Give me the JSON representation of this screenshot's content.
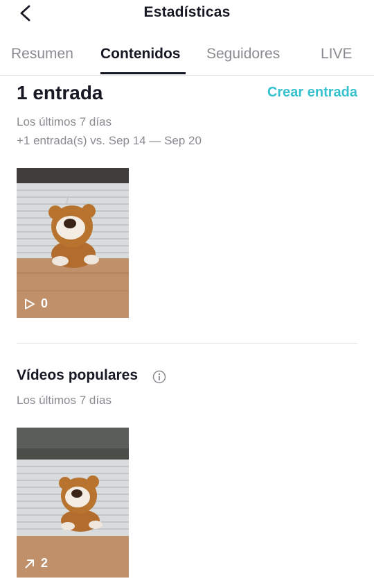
{
  "header": {
    "title": "Estadísticas",
    "back_icon": "chevron-left-icon"
  },
  "tabs": [
    {
      "label": "Resumen",
      "active": false
    },
    {
      "label": "Contenidos",
      "active": true
    },
    {
      "label": "Seguidores",
      "active": false
    },
    {
      "label": "LIVE",
      "active": false
    }
  ],
  "entries": {
    "title": "1 entrada",
    "create_label": "Crear entrada",
    "period": "Los últimos 7 días",
    "comparison": "+1 entrada(s) vs. Sep 14 — Sep 20",
    "post": {
      "icon": "play-icon",
      "views": "0"
    }
  },
  "popular": {
    "title": "Vídeos populares",
    "info_icon": "info-icon",
    "period": "Los últimos 7 días",
    "post": {
      "icon": "trending-arrow-icon",
      "count": "2"
    }
  },
  "colors": {
    "accent": "#36c2cf",
    "text": "#161823",
    "muted": "#8a8b91",
    "divider": "#e3e3e4"
  }
}
